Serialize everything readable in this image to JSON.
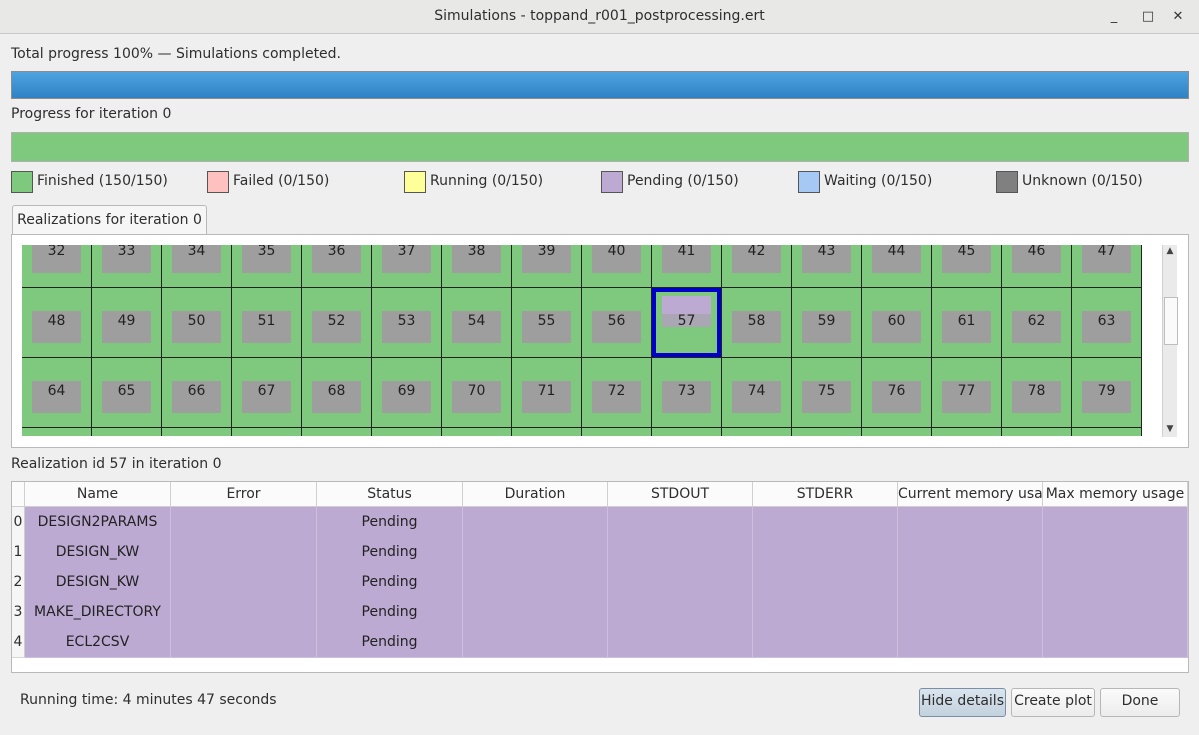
{
  "window": {
    "title": "Simulations - toppand_r001_postprocessing.ert",
    "minimize_glyph": "_",
    "maximize_glyph": "□",
    "close_glyph": "✕"
  },
  "total_progress": {
    "label": "Total progress 100% — Simulations completed.",
    "fraction": 1.0,
    "color": "#3a8fd1"
  },
  "iteration_progress": {
    "label": "Progress for iteration 0",
    "fraction": 1.0,
    "color": "#7fc97f"
  },
  "legend": [
    {
      "label": "Finished (150/150)",
      "color": "#7fc97f"
    },
    {
      "label": "Failed (0/150)",
      "color": "#ffc0c0"
    },
    {
      "label": "Running (0/150)",
      "color": "#ffff99"
    },
    {
      "label": "Pending (0/150)",
      "color": "#bdaad3"
    },
    {
      "label": "Waiting (0/150)",
      "color": "#a6c8f5"
    },
    {
      "label": "Unknown (0/150)",
      "color": "#808080"
    }
  ],
  "realizations_tab": {
    "label": "Realizations for iteration 0"
  },
  "realizations": {
    "rows": [
      [
        "32",
        "33",
        "34",
        "35",
        "36",
        "37",
        "38",
        "39",
        "40",
        "41",
        "42",
        "43",
        "44",
        "45",
        "46",
        "47"
      ],
      [
        "48",
        "49",
        "50",
        "51",
        "52",
        "53",
        "54",
        "55",
        "56",
        "57",
        "58",
        "59",
        "60",
        "61",
        "62",
        "63"
      ],
      [
        "64",
        "65",
        "66",
        "67",
        "68",
        "69",
        "70",
        "71",
        "72",
        "73",
        "74",
        "75",
        "76",
        "77",
        "78",
        "79"
      ],
      [
        "",
        "",
        "",
        "",
        "",
        "",
        "",
        "",
        "",
        "",
        "",
        "",
        "",
        "",
        "",
        ""
      ]
    ],
    "selected": "57"
  },
  "detail": {
    "label": "Realization id 57 in iteration 0",
    "columns": [
      "Name",
      "Error",
      "Status",
      "Duration",
      "STDOUT",
      "STDERR",
      "Current memory usage",
      "Max memory usage"
    ],
    "rows": [
      {
        "index": "0",
        "cells": [
          "DESIGN2PARAMS",
          "",
          "Pending",
          "",
          "",
          "",
          "",
          ""
        ]
      },
      {
        "index": "1",
        "cells": [
          "DESIGN_KW",
          "",
          "Pending",
          "",
          "",
          "",
          "",
          ""
        ]
      },
      {
        "index": "2",
        "cells": [
          "DESIGN_KW",
          "",
          "Pending",
          "",
          "",
          "",
          "",
          ""
        ]
      },
      {
        "index": "3",
        "cells": [
          "MAKE_DIRECTORY",
          "",
          "Pending",
          "",
          "",
          "",
          "",
          ""
        ]
      },
      {
        "index": "4",
        "cells": [
          "ECL2CSV",
          "",
          "Pending",
          "",
          "",
          "",
          "",
          ""
        ]
      }
    ]
  },
  "footer": {
    "running_time": "Running time: 4 minutes 47 seconds",
    "hide_details": "Hide details",
    "create_plot": "Create plot",
    "done": "Done"
  }
}
